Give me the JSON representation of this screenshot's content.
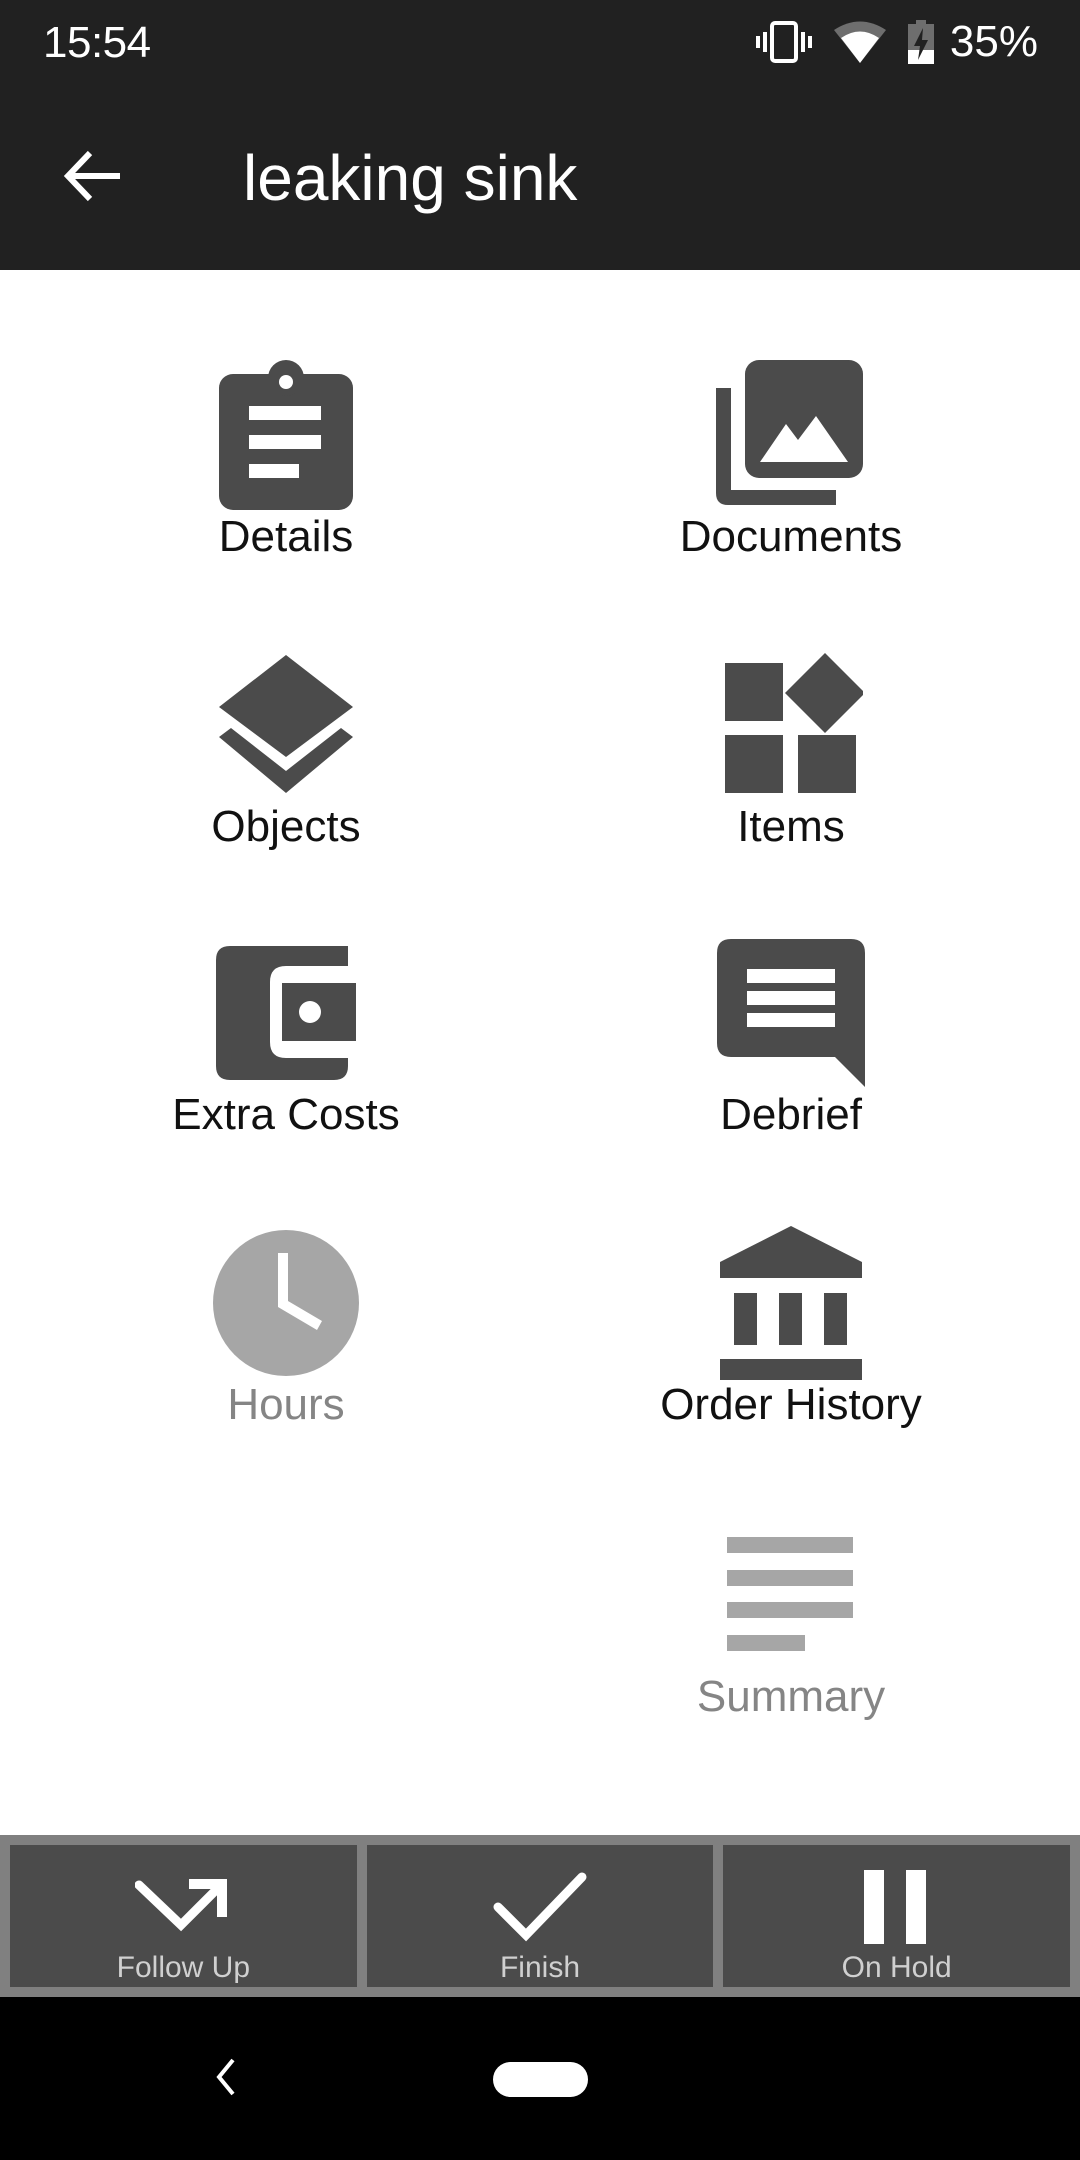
{
  "status_bar": {
    "time": "15:54",
    "battery_percent": "35%",
    "icons": [
      "vibrate-icon",
      "wifi-icon",
      "battery-charging-icon"
    ]
  },
  "app_bar": {
    "back_icon": "arrow-left-icon",
    "title": "leaking sink"
  },
  "menu": {
    "tiles": [
      {
        "label": "Details",
        "icon": "clipboard-icon",
        "enabled": true
      },
      {
        "label": "Documents",
        "icon": "photo-library-icon",
        "enabled": true
      },
      {
        "label": "Objects",
        "icon": "layers-icon",
        "enabled": true
      },
      {
        "label": "Items",
        "icon": "widgets-icon",
        "enabled": true
      },
      {
        "label": "Extra Costs",
        "icon": "wallet-icon",
        "enabled": true
      },
      {
        "label": "Debrief",
        "icon": "chat-bubble-icon",
        "enabled": true
      },
      {
        "label": "Hours",
        "icon": "clock-icon",
        "enabled": false
      },
      {
        "label": "Order History",
        "icon": "bank-icon",
        "enabled": true
      },
      {
        "label": "Summary",
        "icon": "notes-icon",
        "enabled": false
      }
    ]
  },
  "actions": [
    {
      "label": "Follow Up",
      "icon": "follow-up-arrow-icon"
    },
    {
      "label": "Finish",
      "icon": "checkmark-icon"
    },
    {
      "label": "On Hold",
      "icon": "pause-icon"
    }
  ],
  "colors": {
    "app_bar": "#212121",
    "icon_active": "#4b4b4b",
    "icon_disabled": "#a6a6a6",
    "label_disabled": "#858585",
    "action_button": "#4b4b4b",
    "action_bar_border": "#808080"
  }
}
